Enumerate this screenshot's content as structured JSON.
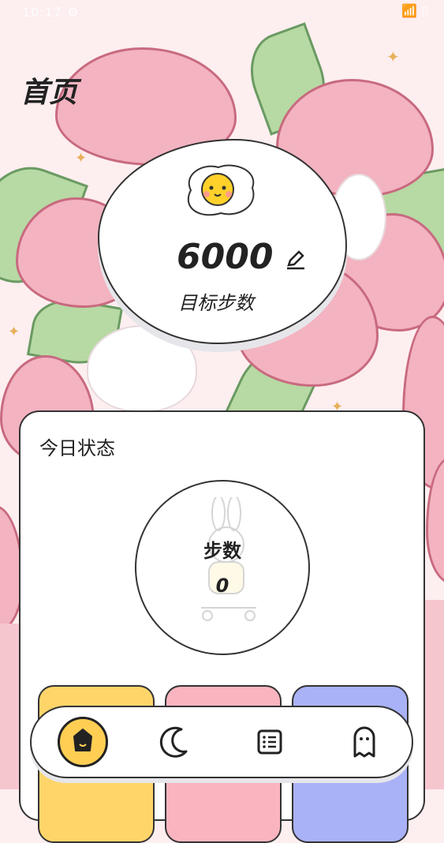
{
  "status_bar": {
    "time": "10:17 ⚙",
    "system": "📶 ▯"
  },
  "page": {
    "title": "首页"
  },
  "goal": {
    "steps": "6000",
    "label": "目标步数"
  },
  "today": {
    "title": "今日状态",
    "steps_label": "步数",
    "steps_value": "0"
  },
  "nav": {
    "items": [
      "home-icon",
      "moon-icon",
      "list-icon",
      "ghost-icon"
    ]
  },
  "colors": {
    "accent_yellow": "#ffce53",
    "tile_pink": "#f9b4c0",
    "tile_blue": "#a9b2f6",
    "background_pink": "#fdeef0"
  }
}
